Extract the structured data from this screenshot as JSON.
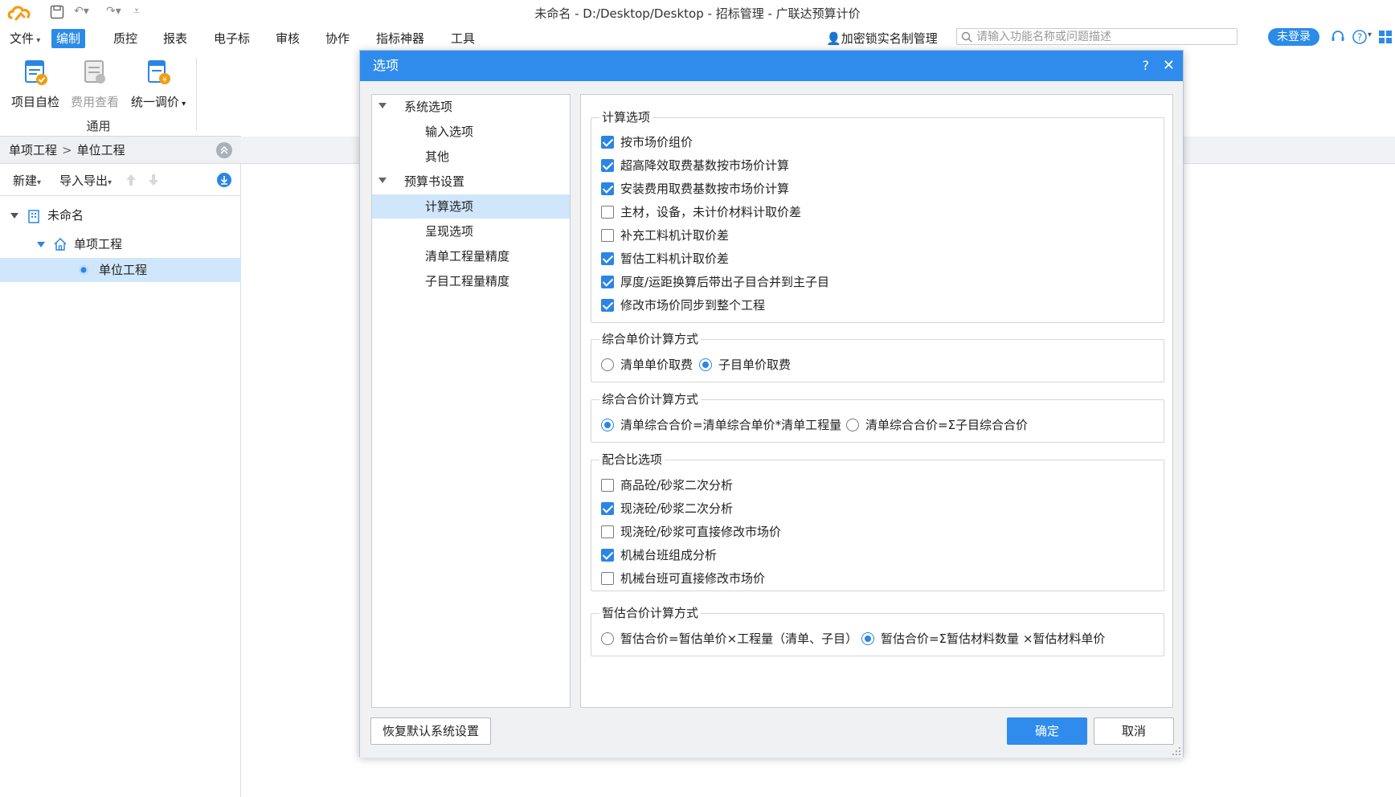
{
  "window": {
    "title": "未命名 - D:/Desktop/Desktop - 招标管理 - 广联达预算计价"
  },
  "menu": {
    "items": [
      "文件",
      "编制",
      "质控",
      "报表",
      "电子标",
      "审核",
      "协作",
      "指标神器",
      "工具"
    ],
    "active_index": 1,
    "lock_label": "加密锁实名制管理",
    "search_placeholder": "请输入功能名称或问题描述",
    "login_label": "未登录"
  },
  "ribbon": {
    "buttons": [
      {
        "label": "项目自检",
        "enabled": true
      },
      {
        "label": "费用查看",
        "enabled": false
      },
      {
        "label": "统一调价",
        "enabled": true
      }
    ],
    "group_label": "通用"
  },
  "left_panel": {
    "breadcrumb": [
      "单项工程",
      "单位工程"
    ],
    "toolbar": {
      "new_label": "新建",
      "import_export_label": "导入导出"
    },
    "tree": [
      {
        "label": "未命名",
        "level": 0
      },
      {
        "label": "单项工程",
        "level": 1
      },
      {
        "label": "单位工程",
        "level": 2,
        "selected": true
      }
    ]
  },
  "dialog": {
    "title": "选项",
    "help_label": "?",
    "close_label": "✕",
    "nav": {
      "items": [
        {
          "label": "系统选项",
          "level": 0,
          "expanded": true
        },
        {
          "label": "输入选项",
          "level": 1
        },
        {
          "label": "其他",
          "level": 1
        },
        {
          "label": "预算书设置",
          "level": 0,
          "expanded": true
        },
        {
          "label": "计算选项",
          "level": 1,
          "selected": true
        },
        {
          "label": "呈现选项",
          "level": 1
        },
        {
          "label": "清单工程量精度",
          "level": 1
        },
        {
          "label": "子目工程量精度",
          "level": 1
        }
      ]
    },
    "groups": {
      "calc": {
        "title": "计算选项",
        "options": [
          {
            "label": "按市场价组价",
            "checked": true
          },
          {
            "label": "超高降效取费基数按市场价计算",
            "checked": true
          },
          {
            "label": "安装费用取费基数按市场价计算",
            "checked": true
          },
          {
            "label": "主材，设备，未计价材料计取价差",
            "checked": false
          },
          {
            "label": "补充工料机计取价差",
            "checked": false
          },
          {
            "label": "暂估工料机计取价差",
            "checked": true
          },
          {
            "label": "厚度/运距换算后带出子目合并到主子目",
            "checked": true
          },
          {
            "label": "修改市场价同步到整个工程",
            "checked": true
          }
        ]
      },
      "unit_price": {
        "title": "综合单价计算方式",
        "options": [
          {
            "label": "清单单价取费",
            "selected": false
          },
          {
            "label": "子目单价取费",
            "selected": true
          }
        ]
      },
      "total_price": {
        "title": "综合合价计算方式",
        "options": [
          {
            "label": "清单综合合价=清单综合单价*清单工程量",
            "selected": true
          },
          {
            "label": "清单综合合价=Σ子目综合合价",
            "selected": false
          }
        ]
      },
      "mix": {
        "title": "配合比选项",
        "options": [
          {
            "label": "商品砼/砂浆二次分析",
            "checked": false
          },
          {
            "label": "现浇砼/砂浆二次分析",
            "checked": true
          },
          {
            "label": "现浇砼/砂浆可直接修改市场价",
            "checked": false
          },
          {
            "label": "机械台班组成分析",
            "checked": true
          },
          {
            "label": "机械台班可直接修改市场价",
            "checked": false
          }
        ]
      },
      "estimate": {
        "title": "暂估合价计算方式",
        "options": [
          {
            "label": "暂估合价=暂估单价×工程量（清单、子目）",
            "selected": false
          },
          {
            "label": "暂估合价=Σ暂估材料数量 ×暂估材料单价",
            "selected": true
          }
        ]
      }
    },
    "buttons": {
      "restore": "恢复默认系统设置",
      "ok": "确定",
      "cancel": "取消"
    }
  },
  "colors": {
    "accent": "#2f8cec",
    "selection": "#cfe6fb"
  }
}
